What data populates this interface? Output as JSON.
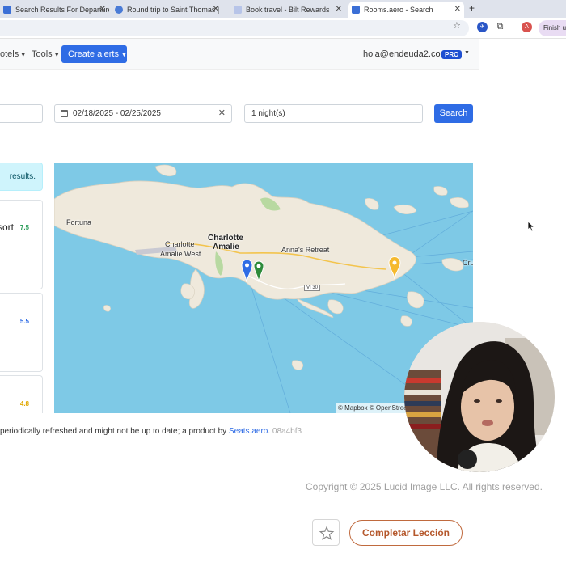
{
  "browser": {
    "tabs": [
      {
        "title": "Search Results For Departure",
        "color": "#3b6fd6"
      },
      {
        "title": "Round trip to Saint Thomas |",
        "color": "#4a7bd6"
      },
      {
        "title": "Book travel - Bilt Rewards",
        "color": "#b7c4e8"
      },
      {
        "title": "Rooms.aero - Search",
        "color": "#3b6fd6",
        "active": true
      }
    ],
    "new_tab": "+",
    "profile_initial": "A",
    "finish_label": "Finish u"
  },
  "navbar": {
    "hotels_label": "otels",
    "tools_label": "Tools",
    "alerts_label": "Create alerts",
    "user_email": "hola@endeuda2.com",
    "pro_badge": "PRO"
  },
  "search": {
    "dates": "02/18/2025 - 02/25/2025",
    "nights": "1 night(s)",
    "button_label": "Search"
  },
  "results": {
    "info_text": "results.",
    "cards": [
      {
        "title": "sort",
        "score": "7.5",
        "score_color": "#2e9e5b"
      },
      {
        "title": "",
        "score": "5.5",
        "score_color": "#2f6ce5"
      },
      {
        "title": "",
        "score": "4.8",
        "score_color": "#e0a800"
      }
    ]
  },
  "map": {
    "labels": {
      "fortuna": "Fortuna",
      "charlotte_amalie": "Charlotte",
      "charlotte_amalie_2": "Amalie",
      "charlotte_amalie_west_1": "Charlotte",
      "charlotte_amalie_west_2": "Amalie West",
      "annas_retreat": "Anna's Retreat",
      "cruz": "Cru",
      "road": "VI 30"
    },
    "attribution": "© Mapbox © OpenStreet"
  },
  "footer": {
    "note_prefix": "periodically refreshed and might not be up to date; a product by",
    "note_link": "Seats.aero",
    "note_hash": "08a4bf3"
  },
  "lesson": {
    "copyright": "Copyright © 2025 Lucid Image LLC. All rights reserved.",
    "complete_label": "Completar Lección"
  }
}
